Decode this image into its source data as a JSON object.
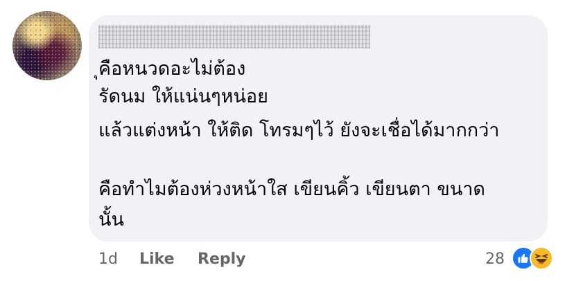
{
  "comment": {
    "lines": [
      "ุคือหนวดอะไม่ต้อง",
      "รัดนม ให้แน่นๆหน่อย",
      "แล้วแต่งหน้า ให้ติด โทรมๆไว้ ยังจะเชื่อได้มากกว่า",
      "",
      "คือทำไมต้องห่วงหน้าใส เขียนคิ้ว เขียนตา ขนาด",
      "นั้น"
    ]
  },
  "footer": {
    "time": "1d",
    "like_label": "Like",
    "reply_label": "Reply",
    "reaction_count": "28",
    "reaction_icons": [
      "like-icon",
      "haha-icon"
    ]
  },
  "colors": {
    "bubble_bg": "#f0f2f5",
    "text": "#050505",
    "meta": "#65676b",
    "like_blue": "#1877f2",
    "haha_yellow": "#f7b928"
  }
}
